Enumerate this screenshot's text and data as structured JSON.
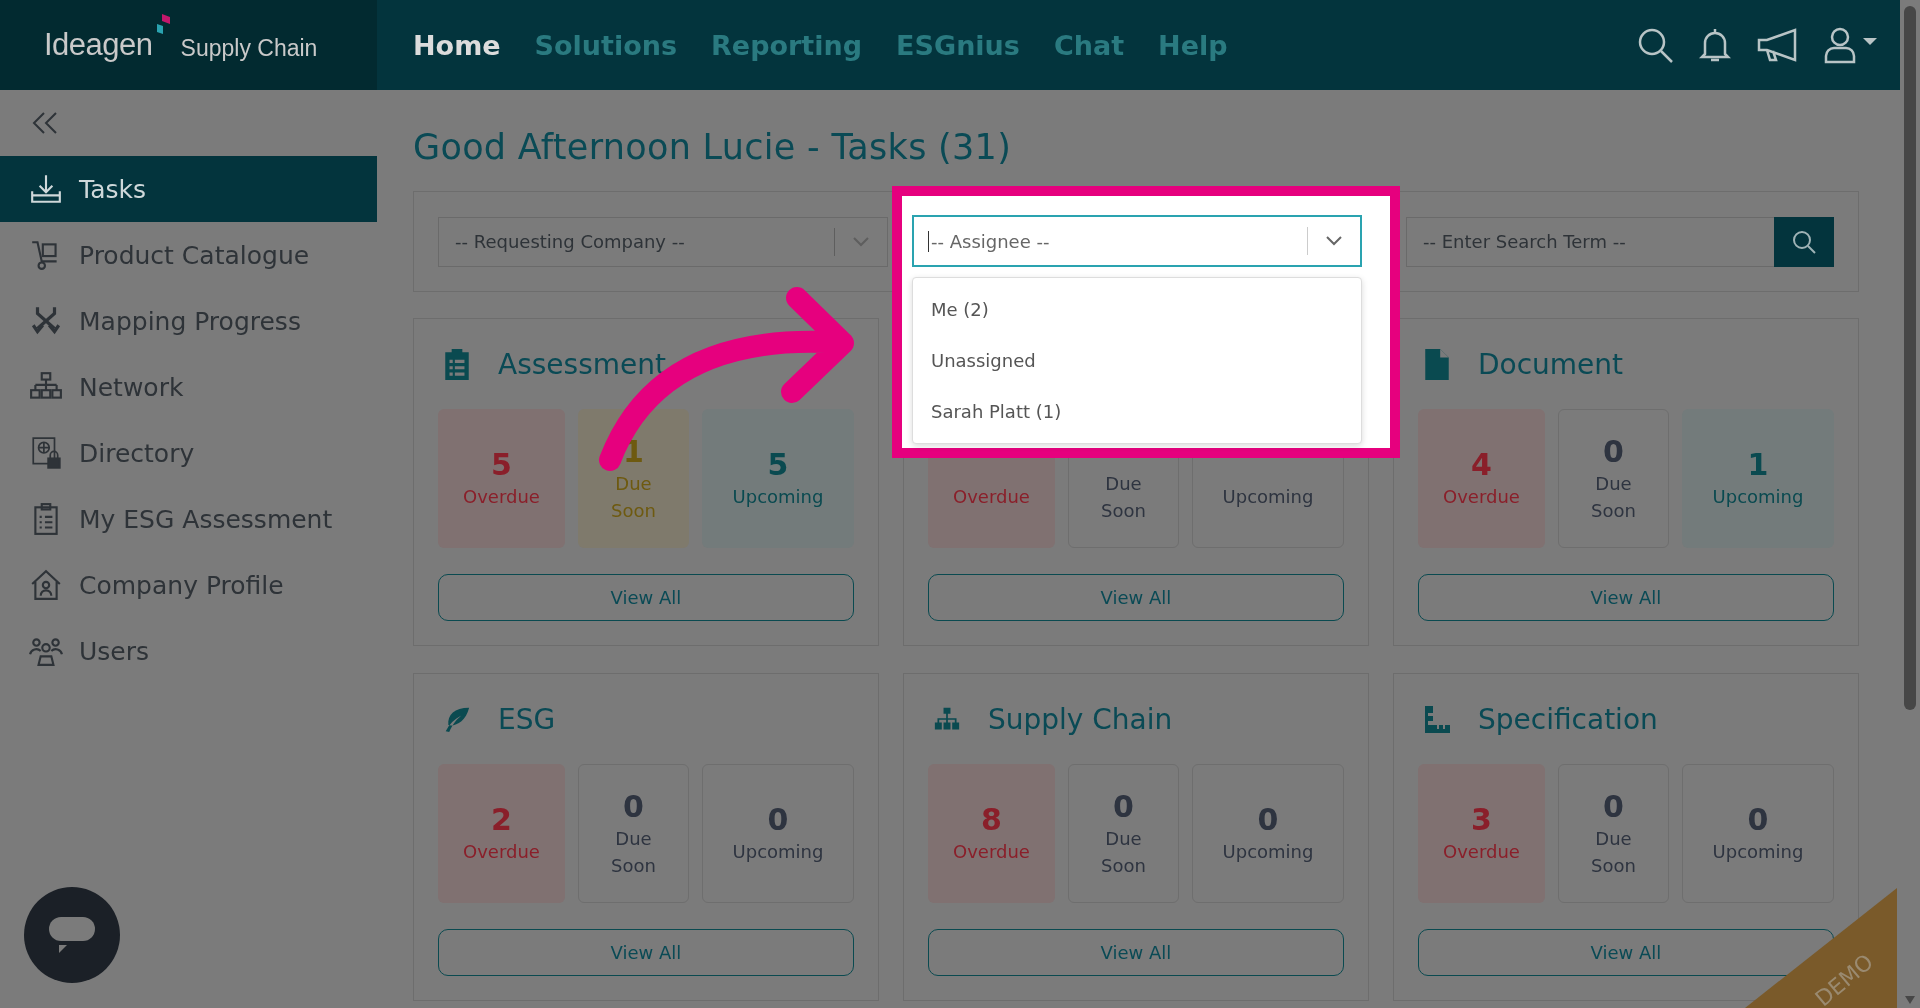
{
  "header": {
    "logo": {
      "brand": "Ideagen",
      "product": "Supply Chain"
    },
    "nav": [
      {
        "label": "Home",
        "selected": true
      },
      {
        "label": "Solutions",
        "selected": false
      },
      {
        "label": "Reporting",
        "selected": false
      },
      {
        "label": "ESGnius",
        "selected": false
      },
      {
        "label": "Chat",
        "selected": false
      },
      {
        "label": "Help",
        "selected": false
      }
    ]
  },
  "sidebar": {
    "items": [
      {
        "label": "Tasks",
        "selected": true
      },
      {
        "label": "Product Catalogue",
        "selected": false
      },
      {
        "label": "Mapping Progress",
        "selected": false
      },
      {
        "label": "Network",
        "selected": false
      },
      {
        "label": "Directory",
        "selected": false
      },
      {
        "label": "My ESG Assessment",
        "selected": false
      },
      {
        "label": "Company Profile",
        "selected": false
      },
      {
        "label": "Users",
        "selected": false
      }
    ]
  },
  "page": {
    "title": "Good Afternoon Lucie - Tasks (31)"
  },
  "filters": {
    "company": {
      "placeholder": "-- Requesting Company --"
    },
    "assignee": {
      "placeholder": "-- Assignee --",
      "expanded": true,
      "options": [
        {
          "label": "Me (2)",
          "selected": false
        },
        {
          "label": "Unassigned",
          "selected": false
        },
        {
          "label": "Sarah Platt (1)",
          "selected": false
        }
      ]
    },
    "search": {
      "placeholder": "-- Enter Search Term --"
    }
  },
  "cards": [
    {
      "title": "Assessment",
      "button": "View All",
      "tiles": [
        {
          "kind": "overdue",
          "value": "5",
          "label": "Overdue",
          "highlighted": true
        },
        {
          "kind": "due_soon",
          "value": "1",
          "label": "Due Soon",
          "highlighted": true
        },
        {
          "kind": "upcoming",
          "value": "5",
          "label": "Upcoming",
          "highlighted": true
        }
      ]
    },
    {
      "button": "View All",
      "tiles": [
        {
          "kind": "overdue",
          "label": "Overdue",
          "highlighted": true
        },
        {
          "kind": "due_soon",
          "label": "Due Soon",
          "highlighted": false
        },
        {
          "kind": "upcoming",
          "label": "Upcoming",
          "highlighted": false
        }
      ]
    },
    {
      "title": "Document",
      "button": "View All",
      "tiles": [
        {
          "kind": "overdue",
          "value": "4",
          "label": "Overdue",
          "highlighted": true
        },
        {
          "kind": "due_soon",
          "value": "0",
          "label": "Due Soon",
          "highlighted": false
        },
        {
          "kind": "upcoming",
          "value": "1",
          "label": "Upcoming",
          "highlighted": true
        }
      ]
    },
    {
      "title": "ESG",
      "button": "View All",
      "tiles": [
        {
          "kind": "overdue",
          "value": "2",
          "label": "Overdue",
          "highlighted": true
        },
        {
          "kind": "due_soon",
          "value": "0",
          "label": "Due Soon",
          "highlighted": false
        },
        {
          "kind": "upcoming",
          "value": "0",
          "label": "Upcoming",
          "highlighted": false
        }
      ]
    },
    {
      "title": "Supply Chain",
      "button": "View All",
      "tiles": [
        {
          "kind": "overdue",
          "value": "8",
          "label": "Overdue",
          "highlighted": true
        },
        {
          "kind": "due_soon",
          "value": "0",
          "label": "Due Soon",
          "highlighted": false
        },
        {
          "kind": "upcoming",
          "value": "0",
          "label": "Upcoming",
          "highlighted": false
        }
      ]
    },
    {
      "title": "Specification",
      "button": "View All",
      "tiles": [
        {
          "kind": "overdue",
          "value": "3",
          "label": "Overdue",
          "highlighted": true
        },
        {
          "kind": "due_soon",
          "value": "0",
          "label": "Due Soon",
          "highlighted": false
        },
        {
          "kind": "upcoming",
          "value": "0",
          "label": "Upcoming",
          "highlighted": false
        }
      ]
    }
  ],
  "badge": {
    "label": "DEMO"
  }
}
